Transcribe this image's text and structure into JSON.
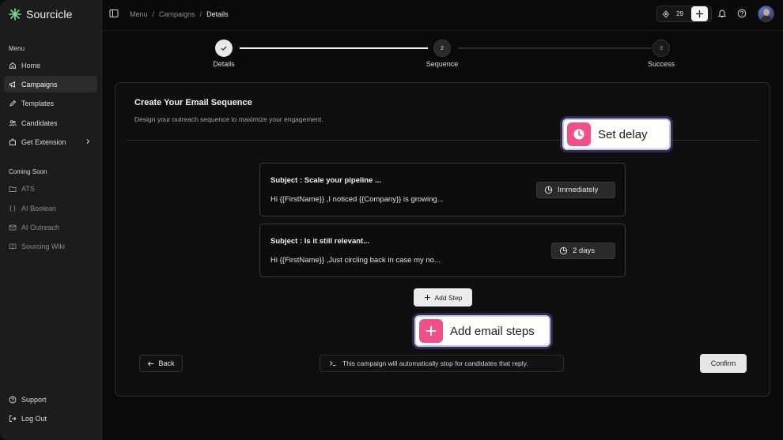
{
  "brand": {
    "name": "Sourcicle"
  },
  "sidebar": {
    "menu_label": "Menu",
    "items": [
      {
        "label": "Home",
        "icon": "home-icon"
      },
      {
        "label": "Campaigns",
        "icon": "megaphone-icon",
        "active": true
      },
      {
        "label": "Templates",
        "icon": "pen-icon"
      },
      {
        "label": "Candidates",
        "icon": "users-icon"
      },
      {
        "label": "Get Extension",
        "icon": "puzzle-icon"
      }
    ],
    "coming_soon_label": "Coming Soon",
    "coming_soon": [
      {
        "label": "ATS",
        "icon": "folder-icon"
      },
      {
        "label": "AI Boolean",
        "icon": "braces-icon"
      },
      {
        "label": "AI Outreach",
        "icon": "mail-icon"
      },
      {
        "label": "Sourcing Wiki",
        "icon": "book-icon"
      }
    ],
    "footer": [
      {
        "label": "Support",
        "icon": "help-circle-icon"
      },
      {
        "label": "Log Out",
        "icon": "logout-icon"
      }
    ]
  },
  "header": {
    "breadcrumb": [
      "Menu",
      "Campaigns",
      "Details"
    ],
    "credits": "29"
  },
  "stepper": {
    "steps": [
      {
        "label": "Details",
        "number": "",
        "state": "done"
      },
      {
        "label": "Sequence",
        "number": "2",
        "state": "current"
      },
      {
        "label": "Success",
        "number": "3",
        "state": "upcoming"
      }
    ]
  },
  "main": {
    "title": "Create Your Email Sequence",
    "subtitle": "Design your outreach sequence to maximize your engagement.",
    "emails": [
      {
        "subject": "Subject : Scale your pipeline ...",
        "preview": "Hi {{FirstName}} ,I noticed {{Company}} is growing...",
        "delay": "Immediately"
      },
      {
        "subject": "Subject : Is it still relevant...",
        "preview": "Hi {{FirstName}} ,Just circling back in case my no...",
        "delay": "2 days"
      }
    ],
    "add_step_label": "Add Step",
    "back_label": "Back",
    "notice": "This campaign will automatically stop for candidates that reply.",
    "confirm_label": "Confirm"
  },
  "callouts": {
    "set_delay": "Set delay",
    "add_steps": "Add email steps"
  },
  "colors": {
    "accent_pink": "#f0508a",
    "callout_border": "#c7c5f5",
    "brand_green": "#7bd88f"
  }
}
